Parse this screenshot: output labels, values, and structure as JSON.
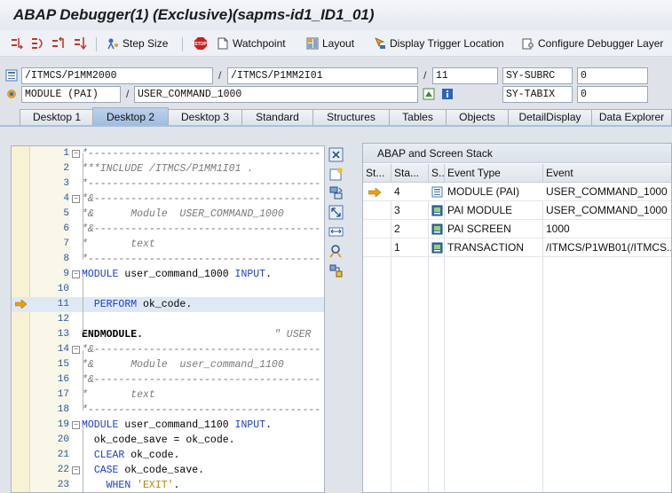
{
  "window": {
    "title": "ABAP Debugger(1)  (Exclusive)(sapms-id1_ID1_01)"
  },
  "toolbar": {
    "step_size": "Step Size",
    "watchpoint": "Watchpoint",
    "layout": "Layout",
    "display_trigger": "Display Trigger Location",
    "configure": "Configure Debugger Layer"
  },
  "vars": {
    "program": "/ITMCS/P1MM2000",
    "include": "/ITMCS/P1MM2I01",
    "line": "11",
    "subrc_label": "SY-SUBRC",
    "subrc_value": "0",
    "event_type": "MODULE (PAI)",
    "event": "USER_COMMAND_1000",
    "tabix_label": "SY-TABIX",
    "tabix_value": "0"
  },
  "tabs": [
    "Desktop 1",
    "Desktop 2",
    "Desktop 3",
    "Standard",
    "Structures",
    "Tables",
    "Objects",
    "DetailDisplay",
    "Data Explorer"
  ],
  "active_tab": "Desktop 2",
  "code": {
    "numbers": [
      "1",
      "2",
      "3",
      "4",
      "5",
      "6",
      "7",
      "8",
      "9",
      "10",
      "11",
      "12",
      "13",
      "14",
      "15",
      "16",
      "17",
      "18",
      "19",
      "20",
      "21",
      "22",
      "23"
    ],
    "lines": [
      "*--------------------------------------",
      "***INCLUDE /ITMCS/P1MM1I01 .",
      "*--------------------------------------",
      "*&-------------------------------------",
      "*&      Module  USER_COMMAND_1000",
      "*&-------------------------------------",
      "*       text",
      "*--------------------------------------",
      "MODULE user_command_1000 INPUT.",
      "",
      "  PERFORM ok_code.",
      "",
      "ENDMODULE.",
      "*&-------------------------------------",
      "*&      Module  user_command_1100",
      "*&-------------------------------------",
      "*       text",
      "*--------------------------------------",
      "MODULE user_command_1100 INPUT.",
      "  ok_code_save = ok_code.",
      "  CLEAR ok_code.",
      "  CASE ok_code_save.",
      "    WHEN 'EXIT'."
    ],
    "endmodule_comment": "\" USER"
  },
  "stack": {
    "title": "ABAP and Screen Stack",
    "headers": [
      "St...",
      "Sta...",
      "S...",
      "Event Type",
      "Event"
    ],
    "rows": [
      {
        "level": "4",
        "type": "MODULE (PAI)",
        "event": "USER_COMMAND_1000",
        "current": true
      },
      {
        "level": "3",
        "type": "PAI MODULE",
        "event": "USER_COMMAND_1000",
        "current": false
      },
      {
        "level": "2",
        "type": "PAI SCREEN",
        "event": "1000",
        "current": false
      },
      {
        "level": "1",
        "type": "TRANSACTION",
        "event": "/ITMCS/P1WB01(/ITMCS...",
        "current": false
      }
    ]
  },
  "colors": {
    "keyword": "#1a3fcf",
    "comment": "#7a7a7a",
    "arrow": "#f0a000",
    "tab_active": "#a9c4e5"
  }
}
